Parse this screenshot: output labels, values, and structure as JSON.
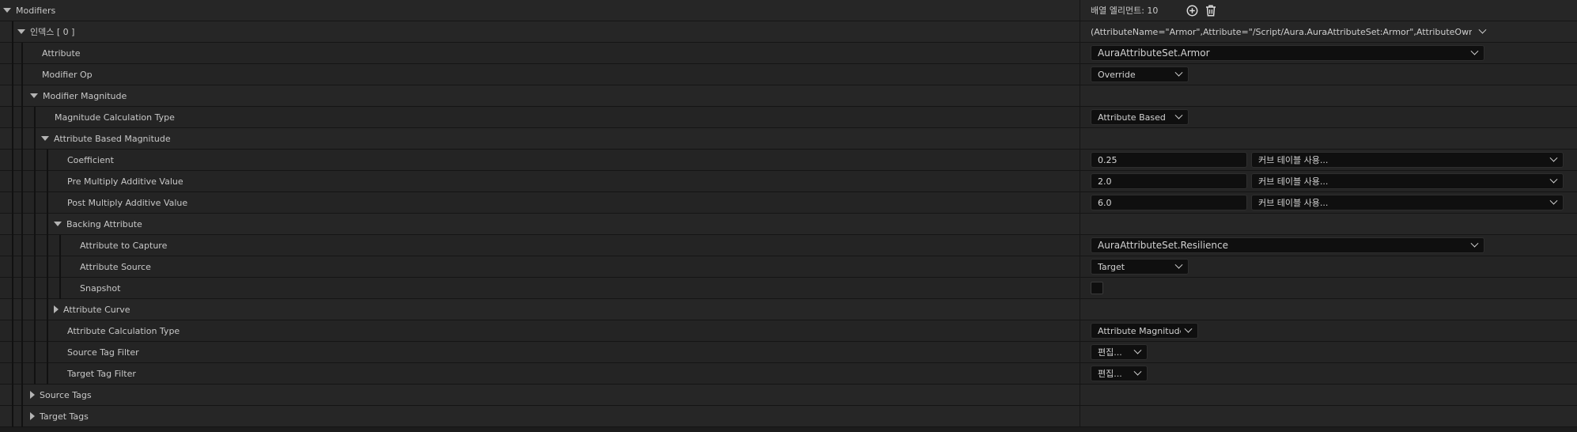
{
  "modifiers": {
    "label": "Modifiers",
    "array_count_label": "배열 엘리먼트: 10"
  },
  "index0": {
    "label": "인덱스 [ 0 ]",
    "summary": "(AttributeName=\"Armor\",Attribute=\"/Script/Aura.AuraAttributeSet:Armor\",AttributeOwner=/S"
  },
  "attribute": {
    "label": "Attribute",
    "value": "AuraAttributeSet.Armor"
  },
  "modifier_op": {
    "label": "Modifier Op",
    "value": "Override"
  },
  "modifier_magnitude": {
    "label": "Modifier Magnitude"
  },
  "magnitude_calc_type": {
    "label": "Magnitude Calculation Type",
    "value": "Attribute Based"
  },
  "attribute_based_magnitude": {
    "label": "Attribute Based Magnitude"
  },
  "coefficient": {
    "label": "Coefficient",
    "value": "0.25",
    "curve": "커브 테이블 사용..."
  },
  "pre_multiply": {
    "label": "Pre Multiply Additive Value",
    "value": "2.0",
    "curve": "커브 테이블 사용..."
  },
  "post_multiply": {
    "label": "Post Multiply Additive Value",
    "value": "6.0",
    "curve": "커브 테이블 사용..."
  },
  "backing_attribute": {
    "label": "Backing Attribute"
  },
  "attribute_to_capture": {
    "label": "Attribute to Capture",
    "value": "AuraAttributeSet.Resilience"
  },
  "attribute_source": {
    "label": "Attribute Source",
    "value": "Target"
  },
  "snapshot": {
    "label": "Snapshot",
    "checked": false
  },
  "attribute_curve": {
    "label": "Attribute Curve"
  },
  "attribute_calc_type": {
    "label": "Attribute Calculation Type",
    "value": "Attribute Magnitude"
  },
  "source_tag_filter": {
    "label": "Source Tag Filter",
    "value": "편집..."
  },
  "target_tag_filter": {
    "label": "Target Tag Filter",
    "value": "편집..."
  },
  "source_tags": {
    "label": "Source Tags"
  },
  "target_tags": {
    "label": "Target Tags"
  },
  "icons": {
    "add": "add-element-icon",
    "delete": "trash-icon",
    "expanded": "expanded-arrow-icon",
    "collapsed": "collapsed-arrow-icon"
  }
}
